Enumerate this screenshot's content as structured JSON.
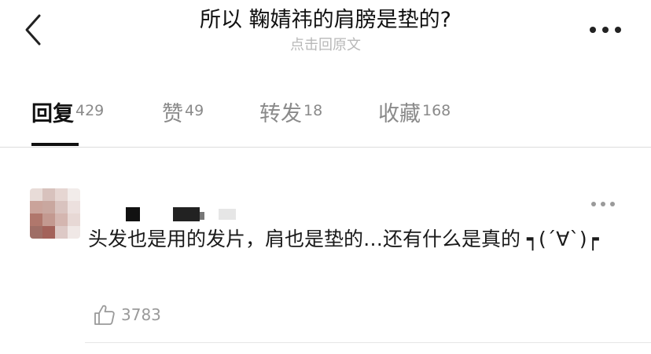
{
  "header": {
    "title": "所以 鞠婧祎的肩膀是垫的?",
    "subtitle": "点击回原文",
    "back_icon": "chevron-left-icon",
    "more_icon": "more-horizontal-icon"
  },
  "tabs": [
    {
      "label": "回复",
      "count": "429",
      "active": true
    },
    {
      "label": "赞",
      "count": "49",
      "active": false
    },
    {
      "label": "转发",
      "count": "18",
      "active": false
    },
    {
      "label": "收藏",
      "count": "168",
      "active": false
    }
  ],
  "comment": {
    "text": "头发也是用的发片，肩也是垫的…还有什么是真的 ┑(´∀`)┍",
    "likes": "3783",
    "like_icon": "thumbs-up-icon",
    "more_icon": "more-horizontal-icon"
  }
}
